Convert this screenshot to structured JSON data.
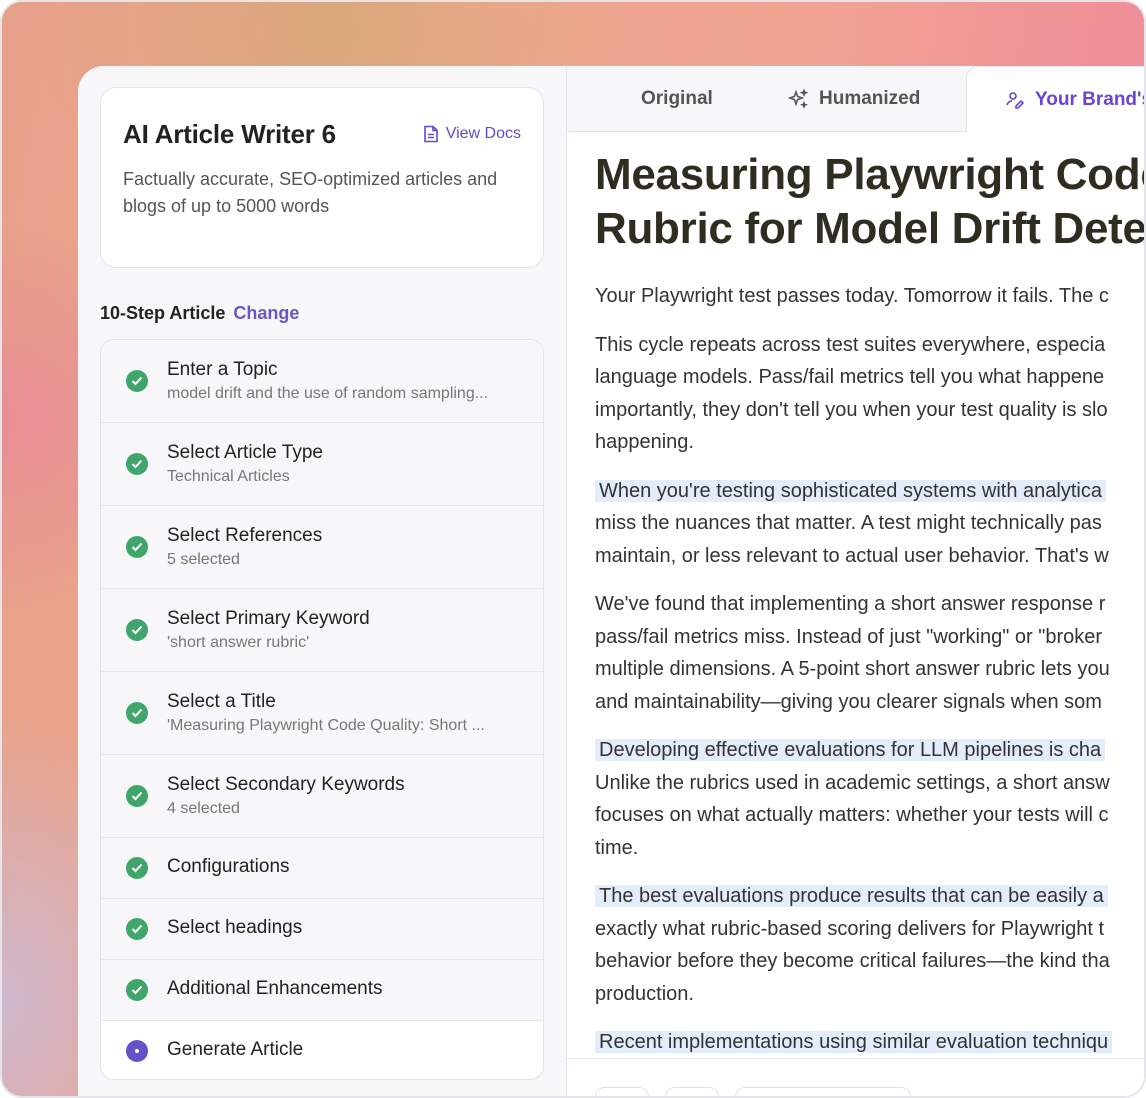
{
  "tool": {
    "title": "AI Article Writer 6",
    "view_docs_label": "View Docs",
    "description": "Factually accurate, SEO-optimized articles and blogs of up to 5000 words"
  },
  "steps_header": {
    "label": "10-Step Article",
    "change_label": "Change"
  },
  "steps": [
    {
      "title": "Enter a Topic",
      "subtitle": "model drift and the use of random sampling...",
      "status": "done"
    },
    {
      "title": "Select Article Type",
      "subtitle": "Technical Articles",
      "status": "done"
    },
    {
      "title": "Select References",
      "subtitle": "5 selected",
      "status": "done"
    },
    {
      "title": "Select Primary Keyword",
      "subtitle": "'short answer rubric'",
      "status": "done"
    },
    {
      "title": "Select a Title",
      "subtitle": "'Measuring Playwright Code Quality: Short ...",
      "status": "done"
    },
    {
      "title": "Select Secondary Keywords",
      "subtitle": "4 selected",
      "status": "done"
    },
    {
      "title": "Configurations",
      "subtitle": "",
      "status": "done"
    },
    {
      "title": "Select headings",
      "subtitle": "",
      "status": "done"
    },
    {
      "title": "Additional Enhancements",
      "subtitle": "",
      "status": "done"
    },
    {
      "title": "Generate Article",
      "subtitle": "",
      "status": "current"
    }
  ],
  "tabs": [
    {
      "label": "Original"
    },
    {
      "label": "Humanized"
    },
    {
      "label": "Your Brand's"
    }
  ],
  "article": {
    "title_line1": "Measuring Playwright Code",
    "title_line2": "Rubric for Model Drift Detec",
    "p1": "Your Playwright test passes today. Tomorrow it fails. The c",
    "p2": [
      "This cycle repeats across test suites everywhere, especia",
      "language models. Pass/fail metrics tell you what happene",
      "importantly, they don't tell you when your test quality is slo",
      "happening."
    ],
    "p3_hl": "When you're testing sophisticated systems with analytica",
    "p3": [
      "miss the nuances that matter. A test might technically pas",
      "maintain, or less relevant to actual user behavior. That's w"
    ],
    "p4": [
      "We've found that implementing a short answer response r",
      "pass/fail metrics miss. Instead of just \"working\" or \"broker",
      "multiple dimensions. A 5-point short answer rubric lets you",
      "and maintainability—giving you clearer signals when som"
    ],
    "p5_hl": "Developing effective evaluations for LLM pipelines is cha",
    "p5": [
      "Unlike the rubrics used in academic settings, a short answ",
      "focuses on what actually matters: whether your tests will c",
      "time."
    ],
    "p6_hl": "The best evaluations produce results that can be easily a",
    "p6": [
      "exactly what rubric-based scoring delivers for Playwright t",
      "behavior before they become critical failures—the kind tha",
      "production."
    ],
    "p7_hl": "Recent implementations using similar evaluation techniqu"
  },
  "colors": {
    "accent": "#6a45d1",
    "success": "#3fa56b",
    "highlight": "#e3ecfa"
  }
}
